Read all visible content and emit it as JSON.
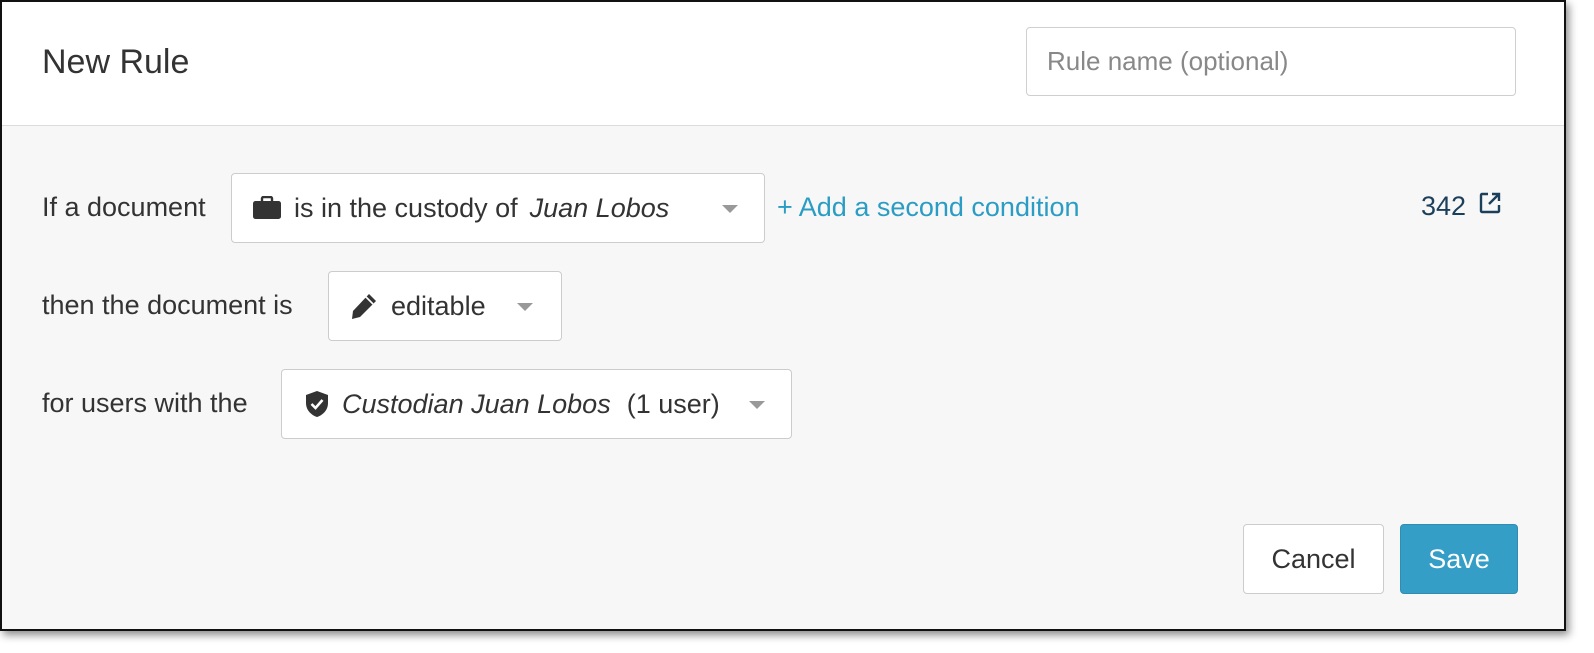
{
  "dialog": {
    "title": "New Rule",
    "name_placeholder": "Rule name (optional)"
  },
  "condition": {
    "prefix": "If a document",
    "icon": "briefcase-icon",
    "predicate": "is in the custody of",
    "value": "Juan Lobos",
    "add_condition_label": "+ Add a second condition",
    "match_count": "342",
    "count_icon": "external-link-icon"
  },
  "permission": {
    "prefix": "then the document is",
    "icon": "pencil-icon",
    "value": "editable"
  },
  "audience": {
    "prefix": "for users with the",
    "icon": "shield-check-icon",
    "role": "Custodian Juan Lobos",
    "user_count": "(1 user)"
  },
  "actions": {
    "cancel_label": "Cancel",
    "save_label": "Save"
  },
  "colors": {
    "accent": "#359ec6",
    "link": "#2b9cc4",
    "count": "#1c3f5c",
    "panel_bg": "#f7f7f7"
  }
}
